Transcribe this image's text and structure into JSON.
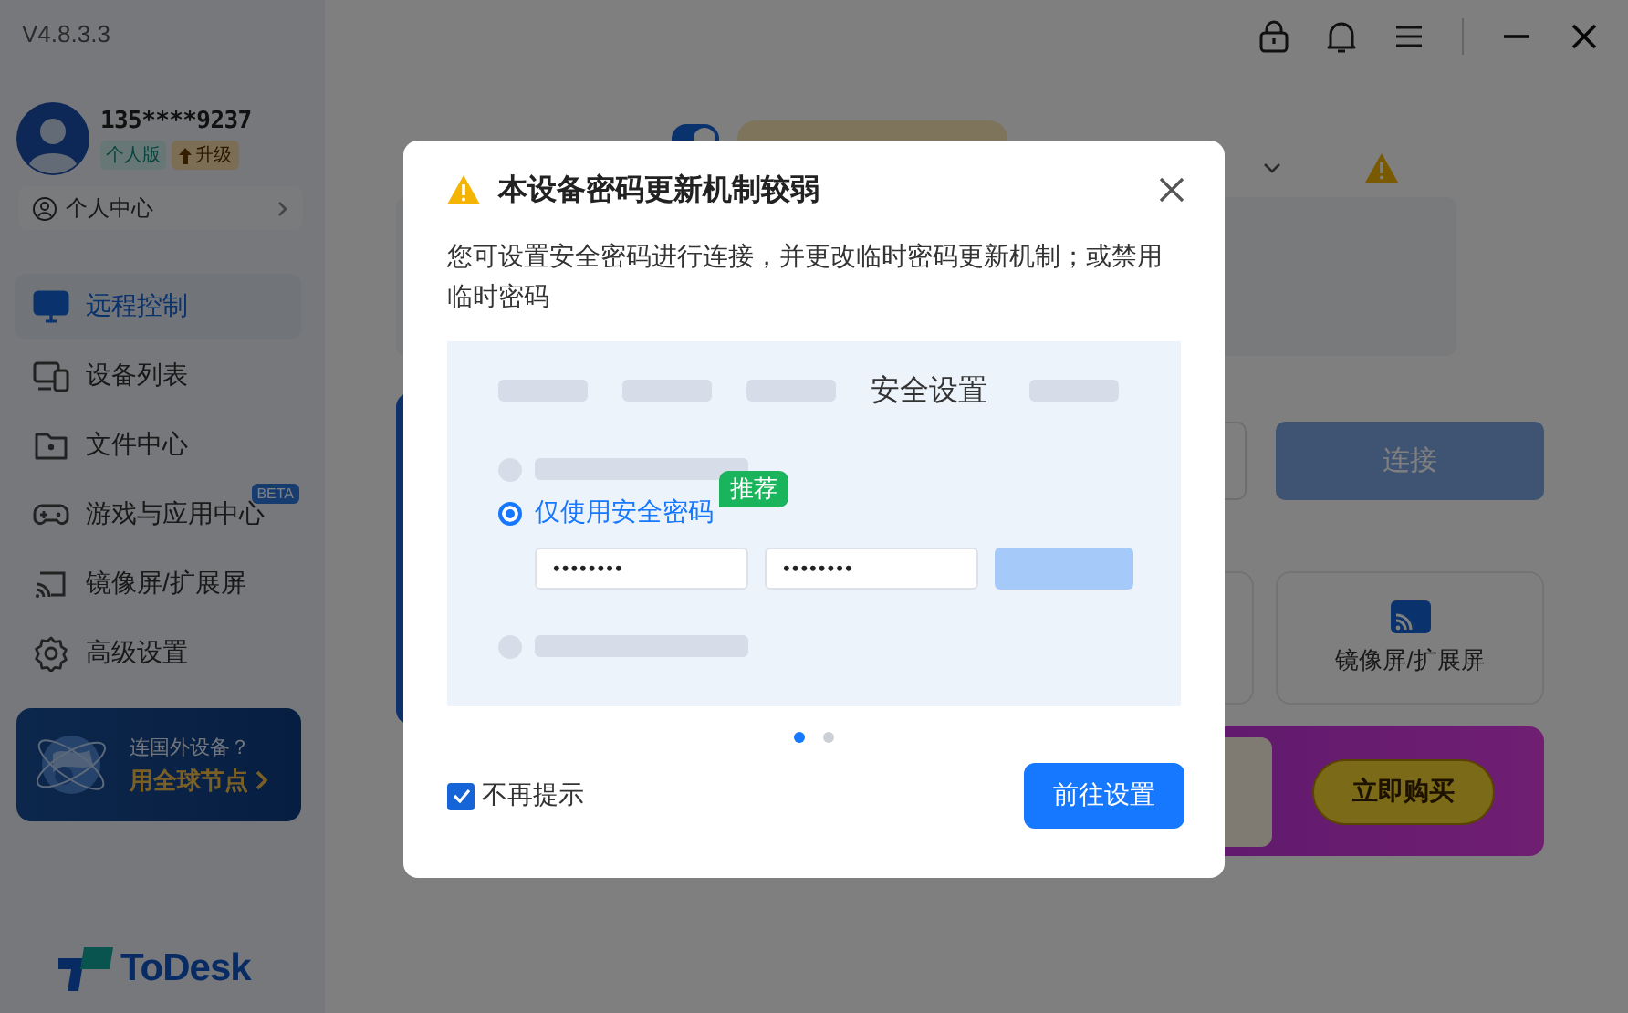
{
  "window": {
    "version": "V4.8.3.3"
  },
  "account": {
    "phone": "135****9237",
    "edition": "个人版",
    "upgrade": "升级",
    "center": "个人中心"
  },
  "sidebar": {
    "items": [
      {
        "label": "远程控制",
        "selected": true
      },
      {
        "label": "设备列表",
        "selected": false
      },
      {
        "label": "文件中心",
        "selected": false
      },
      {
        "label": "游戏与应用中心",
        "selected": false,
        "badge": "BETA"
      },
      {
        "label": "镜像屏/扩展屏",
        "selected": false
      },
      {
        "label": "高级设置",
        "selected": false
      }
    ]
  },
  "promo": {
    "question": "连国外设备？",
    "action": "用全球节点"
  },
  "logo": "ToDesk",
  "main": {
    "allow_control": true,
    "connect": "连接",
    "card": "镜像屏/扩展屏",
    "buy": "立即购买"
  },
  "dialog": {
    "title": "本设备密码更新机制较弱",
    "text": "您可设置安全密码进行连接，并更改临时密码更新机制；或禁用临时密码",
    "illustration": {
      "tab": "安全设置",
      "options": [
        {
          "kind": "placeholder",
          "selected": false
        },
        {
          "kind": "option",
          "label": "仅使用安全密码",
          "tag": "推荐",
          "selected": true
        },
        {
          "kind": "placeholder",
          "selected": false
        }
      ],
      "passwords": [
        "••••••••",
        "••••••••"
      ]
    },
    "pages": [
      {
        "selected": true
      },
      {
        "selected": false
      }
    ],
    "dont_show": {
      "label": "不再提示",
      "checked": true
    },
    "button": "前往设置"
  }
}
